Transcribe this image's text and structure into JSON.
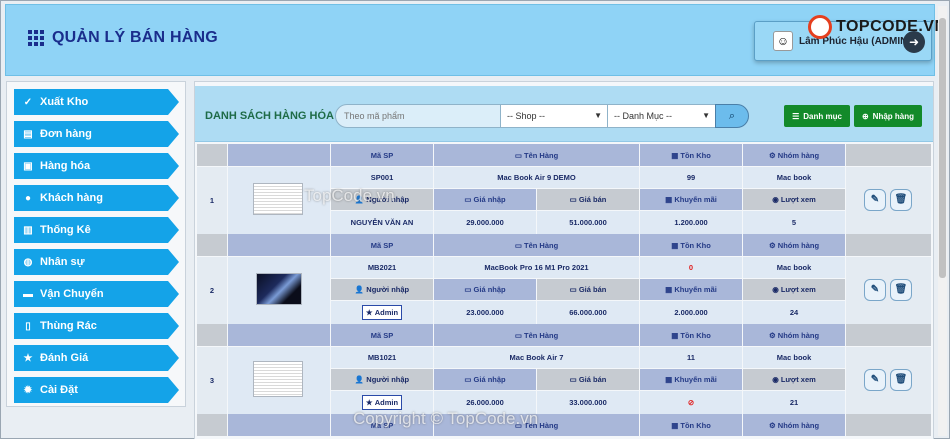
{
  "header": {
    "title": "QUẢN LÝ BÁN HÀNG",
    "user_name": "Lâm Phúc Hậu (ADMIN)",
    "logo_text": "TOPCODE.VN"
  },
  "sidebar": {
    "items": [
      {
        "label": "Xuất Kho",
        "icon": "check-icon"
      },
      {
        "label": "Đơn hàng",
        "icon": "receipt-icon"
      },
      {
        "label": "Hàng hóa",
        "icon": "box-icon"
      },
      {
        "label": "Khách hàng",
        "icon": "user-circle-icon"
      },
      {
        "label": "Thống Kê",
        "icon": "chart-icon"
      },
      {
        "label": "Nhân sự",
        "icon": "users-icon"
      },
      {
        "label": "Vận Chuyển",
        "icon": "truck-icon"
      },
      {
        "label": "Thùng Rác",
        "icon": "trash-icon"
      },
      {
        "label": "Đánh Giá",
        "icon": "star-icon"
      },
      {
        "label": "Cài Đặt",
        "icon": "gear-icon"
      }
    ]
  },
  "toolbar": {
    "title": "DANH SÁCH HÀNG HÓA",
    "search_placeholder": "Theo mã phẩm",
    "shop_select": "-- Shop --",
    "category_select": "-- Danh Mục --",
    "category_button": "Danh mục",
    "import_button": "Nhập hàng"
  },
  "table": {
    "header_labels": {
      "code": "Mã SP",
      "name": "Tên Hàng",
      "stock": "Tồn Kho",
      "group": "Nhóm hàng",
      "importer": "Người nhập",
      "import_price": "Giá nhập",
      "sale_price": "Giá bán",
      "promo": "Khuyến mãi",
      "views": "Lượt xem"
    },
    "rows": [
      {
        "index": "1",
        "code": "SP001",
        "name": "Mac Book Air 9 DEMO",
        "stock": "99",
        "group": "Mac book",
        "importer": "NGUYỄN VĂN AN",
        "import_price": "29.000.000",
        "sale_price": "51.000.000",
        "promo": "1.200.000",
        "views": "5"
      },
      {
        "index": "2",
        "code": "MB2021",
        "name": "MacBook Pro 16 M1 Pro 2021",
        "stock": "0",
        "group": "Mac book",
        "importer": "Admin",
        "import_price": "23.000.000",
        "sale_price": "66.000.000",
        "promo": "2.000.000",
        "views": "24"
      },
      {
        "index": "3",
        "code": "MB1021",
        "name": "Mac Book Air 7",
        "stock": "11",
        "group": "Mac book",
        "importer": "Admin",
        "import_price": "26.000.000",
        "sale_price": "33.000.000",
        "promo": "⊘",
        "views": "21"
      }
    ]
  },
  "watermarks": {
    "mid": "TopCode.vn",
    "bottom": "Copyright © TopCode.vn"
  }
}
